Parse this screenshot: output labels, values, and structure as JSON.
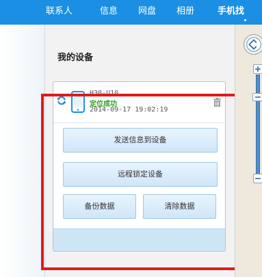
{
  "topnav": {
    "items": [
      "联系人",
      "信息",
      "网盘",
      "相册",
      "手机找"
    ],
    "active_index": 4
  },
  "panel": {
    "title": "我的设备"
  },
  "device": {
    "name": "H30-U10",
    "status": "定位成功",
    "time": "2014-09-17 19:02:19"
  },
  "actions": {
    "send_message": "发送信息到设备",
    "remote_lock": "远程锁定设备",
    "backup": "备份数据",
    "erase": "清除数据"
  },
  "icons": {
    "refresh": "refresh-icon",
    "phone": "phone-icon",
    "trash": "trash-icon",
    "pan": "map-pan-icon",
    "zoom_in": "plus-icon",
    "zoom_out": "minus-icon"
  },
  "colors": {
    "nav_bg": "#1a8fe3",
    "status_green": "#2ca01c",
    "accent_blue": "#1a8fe3",
    "highlight_red": "#e11a1a",
    "button_bg": "#d9ecfa"
  }
}
